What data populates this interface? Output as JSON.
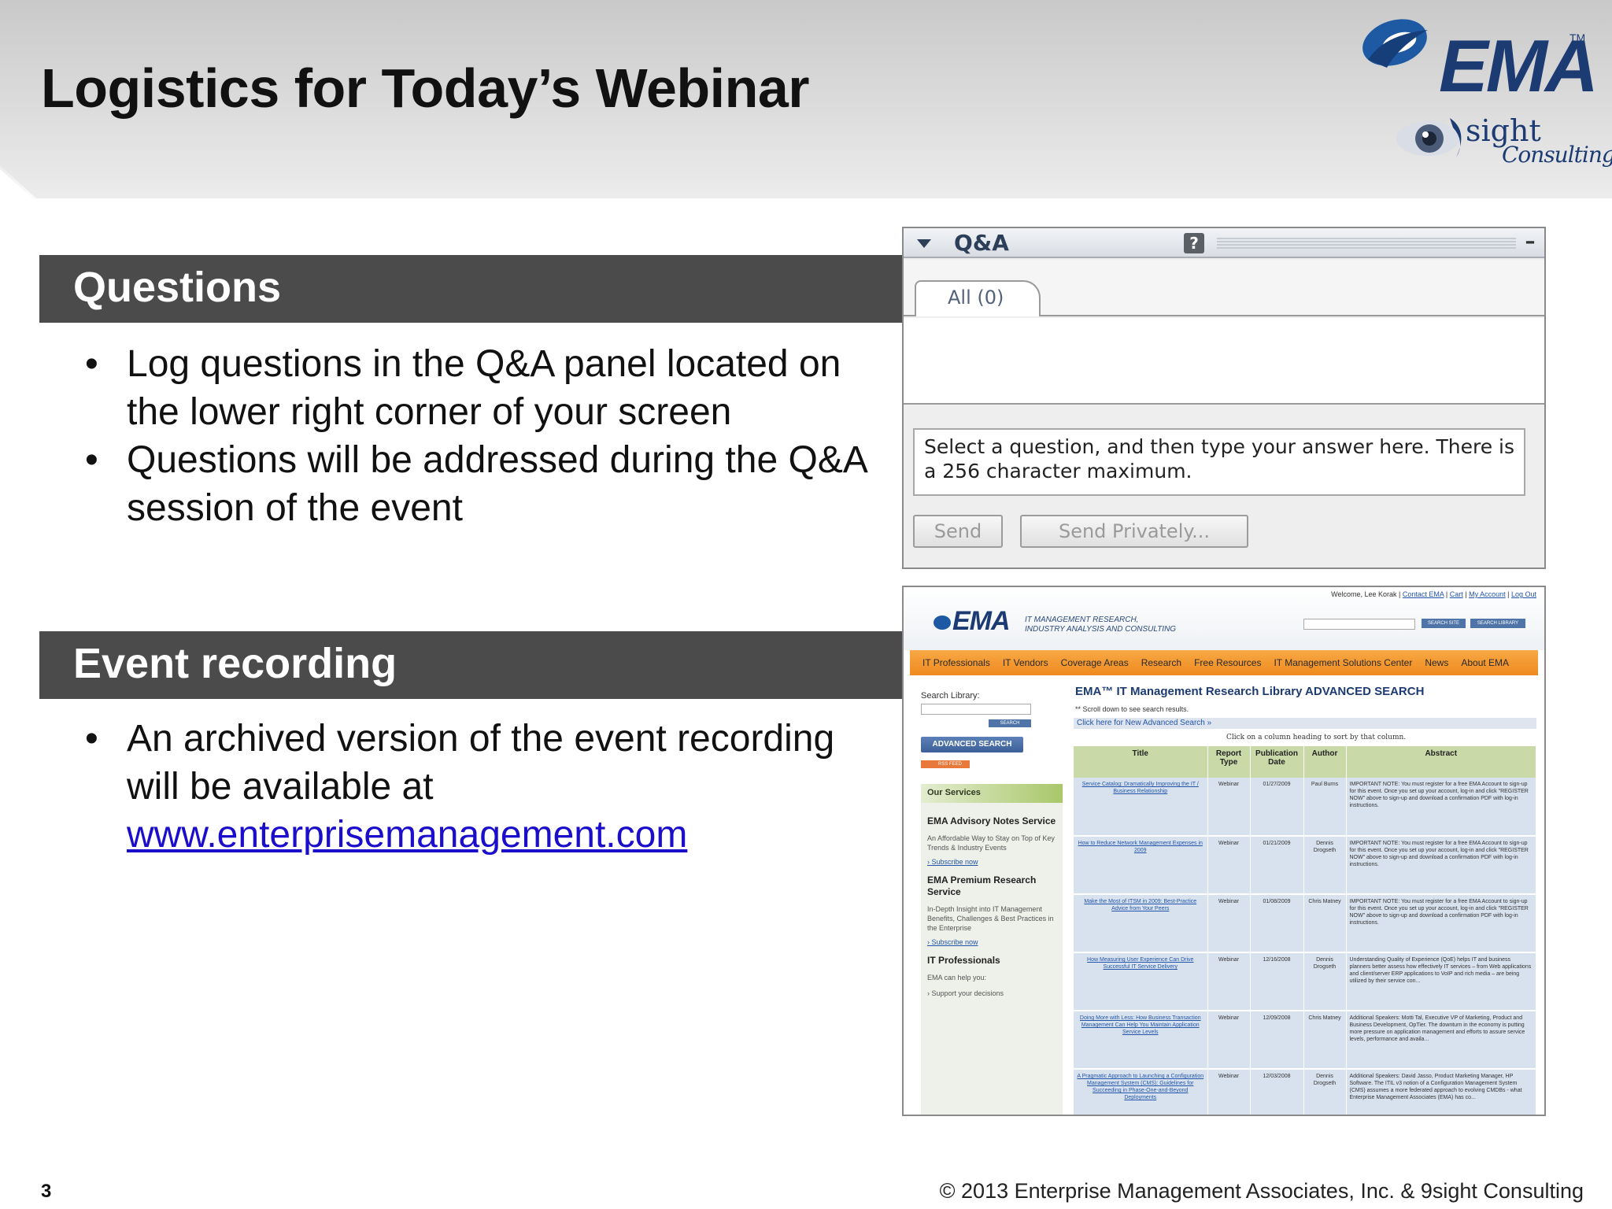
{
  "slide": {
    "title": "Logistics for Today’s Webinar",
    "page_number": "3",
    "copyright": "© 2013 Enterprise Management Associates, Inc. & 9sight Consulting"
  },
  "logos": {
    "ema": "EMA",
    "ema_tm": "TM",
    "sight": "sight",
    "consulting": "Consulting"
  },
  "sections": {
    "questions": {
      "heading": "Questions",
      "bullets": [
        "Log questions in the Q&A panel located on the lower right corner of your screen",
        "Questions will be addressed during the Q&A session of the event"
      ]
    },
    "recording": {
      "heading": "Event recording",
      "bullet_text": "An archived version of the event recording will be available at",
      "link": "www.enterprisemanagement.com"
    }
  },
  "qa_panel": {
    "title": "Q&A",
    "help": "?",
    "minimize": "–",
    "tab_all": "All (0)",
    "answer_text": "Select a question, and then type your answer here. There is a 256 character maximum.",
    "send_label": "Send",
    "send_privately_label": "Send Privately..."
  },
  "website": {
    "welcome": "Welcome, Lee Korak |",
    "top_links": [
      "Contact EMA",
      "Cart",
      "My Account",
      "Log Out"
    ],
    "logo": "EMA",
    "tagline": "IT MANAGEMENT RESEARCH,\nINDUSTRY ANALYSIS AND CONSULTING",
    "search_site": "SEARCH SITE",
    "search_library": "SEARCH LIBRARY",
    "nav": [
      "IT Professionals",
      "IT Vendors",
      "Coverage Areas",
      "Research",
      "Free Resources",
      "IT Management Solutions Center",
      "News",
      "About EMA"
    ],
    "search_library_label": "Search Library:",
    "search_btn": "SEARCH",
    "advanced_search": "ADVANCED SEARCH",
    "rss": "RSS FEED",
    "our_services": "Our Services",
    "services": [
      {
        "title": "EMA Advisory Notes Service",
        "desc": "An Affordable Way to Stay on Top of Key Trends & Industry Events",
        "link": "› Subscribe now"
      },
      {
        "title": "EMA Premium Research Service",
        "desc": "In-Depth Insight into IT Management Benefits, Challenges & Best Practices in the Enterprise",
        "link": "› Subscribe now"
      },
      {
        "title": "IT Professionals",
        "desc": "EMA can help you:",
        "link": "› Support your decisions"
      }
    ],
    "main_title": "EMA™ IT Management Research Library ADVANCED SEARCH",
    "scroll_note": "** Scroll down to see search results.",
    "new_search": "Click here for New Advanced Search »",
    "click_hint": "Click on a column heading to sort by that column.",
    "table_headers": [
      "Title",
      "Report Type",
      "Publication Date",
      "Author",
      "Abstract"
    ],
    "table_rows": [
      [
        "Service Catalog: Dramatically Improving the IT / Business Relationship",
        "Webinar",
        "01/27/2009",
        "Paul Burns",
        "IMPORTANT NOTE: You must register for a free EMA Account to sign-up for this event. Once you set up your account, log-in and click \"REGISTER NOW\" above to sign-up and download a confirmation PDF with log-in instructions."
      ],
      [
        "How to Reduce Network Management Expenses in 2009",
        "Webinar",
        "01/21/2009",
        "Dennis Drogseth",
        "IMPORTANT NOTE: You must register for a free EMA Account to sign-up for this event. Once you set up your account, log-in and click \"REGISTER NOW\" above to sign-up and download a confirmation PDF with log-in instructions."
      ],
      [
        "Make the Most of ITSM in 2009: Best-Practice Advice from Your Peers",
        "Webinar",
        "01/08/2009",
        "Chris Matney",
        "IMPORTANT NOTE: You must register for a free EMA Account to sign-up for this event. Once you set up your account, log-in and click \"REGISTER NOW\" above to sign-up and download a confirmation PDF with log-in instructions."
      ],
      [
        "How Measuring User Experience Can Drive Successful IT Service Delivery",
        "Webinar",
        "12/16/2008",
        "Dennis Drogseth",
        "Understanding Quality of Experience (QoE) helps IT and business planners better assess how effectively IT services – from Web applications and client/server ERP applications to VoIP and rich media – are being utilized by their service con..."
      ],
      [
        "Doing More with Less: How Business Transaction Management Can Help You Maintain Application Service Levels",
        "Webinar",
        "12/09/2008",
        "Chris Matney",
        "Additional Speakers: Motti Tal, Executive VP of Marketing, Product and Business Development, OpTier. The downturn in the economy is putting more pressure on application management and efforts to assure service levels, performance and availa..."
      ],
      [
        "A Pragmatic Approach to Launching a Configuration Management System (CMS): Guidelines for Succeeding in Phase-One-and-Beyond Deployments",
        "Webinar",
        "12/03/2008",
        "Dennis Drogseth",
        "Additional Speakers: David Jasso, Product Marketing Manager, HP Software. The ITIL v3 notion of a Configuration Management System (CMS) assumes a more federated approach to evolving CMDBs - what Enterprise Management Associates (EMA) has co..."
      ]
    ]
  }
}
